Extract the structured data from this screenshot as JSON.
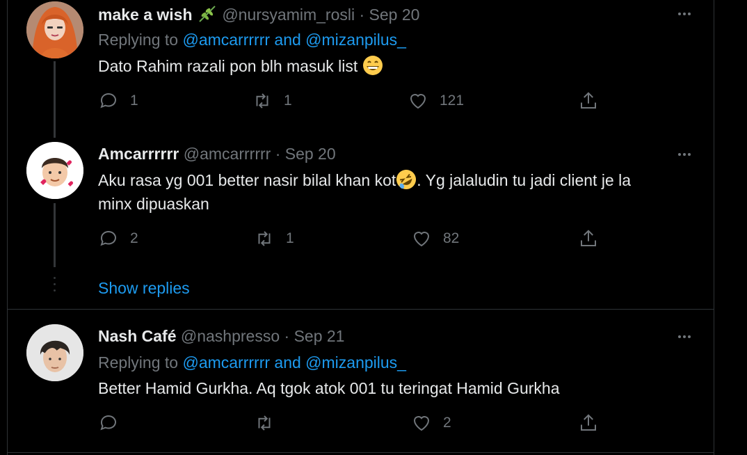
{
  "tweets": [
    {
      "name": "make a wish",
      "handle": "@nursyamim_rosli",
      "date": "· Sep 20",
      "replying_prefix": "Replying to ",
      "replying_user1": "@amcarrrrrr",
      "replying_and": " and ",
      "replying_user2": "@mizanpilus_",
      "text": "Dato Rahim razali pon blh masuk list",
      "replies": "1",
      "retweets": "1",
      "likes": "121",
      "emoji": "grinning-face-emoji",
      "name_emoji": "herb-emoji"
    },
    {
      "name": "Amcarrrrrr",
      "handle": "@amcarrrrrr",
      "date": "· Sep 20",
      "text_part1": "Aku rasa yg 001 better nasir bilal khan kot",
      "text_part2": ". Yg jalaludin tu jadi client je la",
      "text_line2": "minx dipuaskan",
      "replies": "2",
      "retweets": "1",
      "likes": "82",
      "emoji": "rolling-laughing-emoji"
    },
    {
      "name": "Nash Café",
      "handle": "@nashpresso",
      "date": "· Sep 21",
      "replying_prefix": "Replying to ",
      "replying_user1": "@amcarrrrrr",
      "replying_and": " and ",
      "replying_user2": "@mizanpilus_",
      "text": "Better Hamid Gurkha. Aq tgok atok 001 tu teringat Hamid Gurkha",
      "replies": "",
      "retweets": "",
      "likes": "2"
    }
  ],
  "show_replies": "Show replies",
  "colors": {
    "background": "#000000",
    "text": "#e7e9ea",
    "muted": "#71767b",
    "link": "#1d9bf0",
    "border": "#2f3336"
  }
}
